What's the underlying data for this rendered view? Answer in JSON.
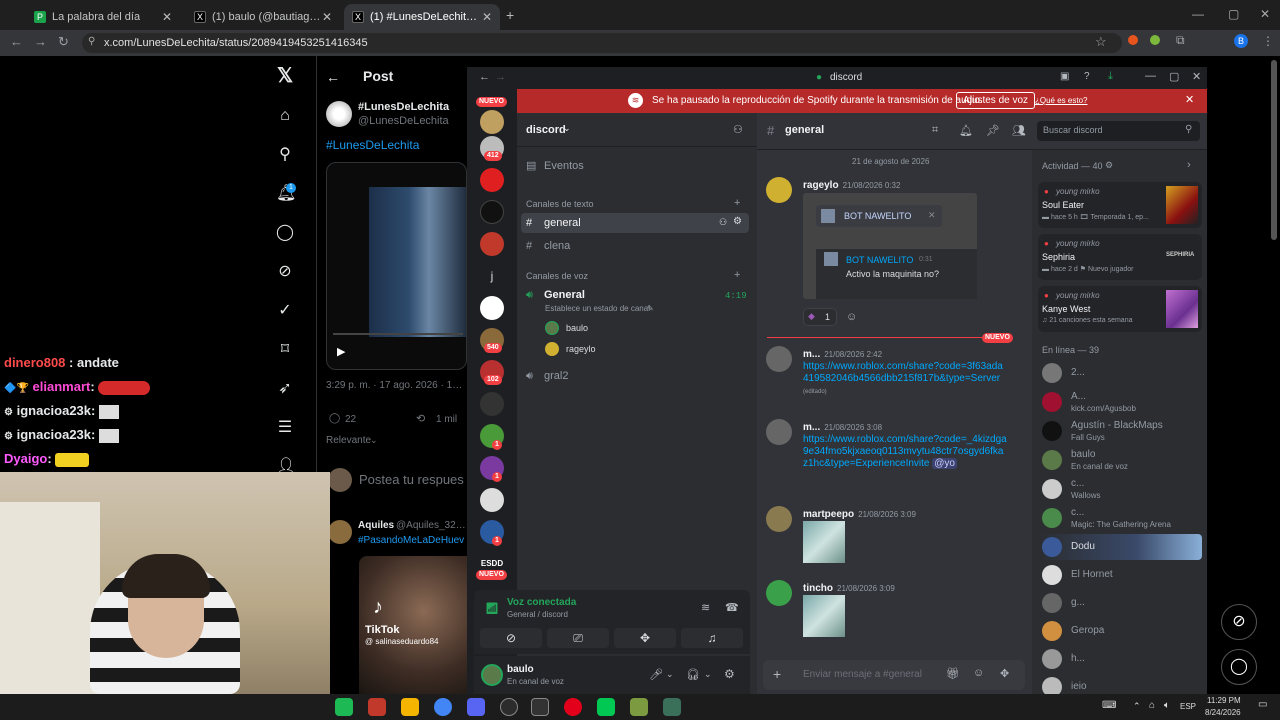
{
  "browser": {
    "tabs": [
      {
        "title": "La palabra del día",
        "fav": "P",
        "fav_color": "#1aa34a"
      },
      {
        "title": "(1) baulo (@bautiagnone) / X",
        "fav": "X",
        "fav_color": "#000000"
      },
      {
        "title": "(1) #LunesDeLechita en X: \"#Lu",
        "fav": "X",
        "fav_color": "#000000"
      }
    ],
    "new_tab": "+",
    "url": "x.com/LunesDeLechita/status/2089419453251416345"
  },
  "x_page": {
    "header_title": "Post",
    "post": {
      "display_name": "#LunesDeLechita",
      "handle": "@LunesDeLechita",
      "body": "#LunesDeLechita",
      "timestamp": "3:29 p. m. · 17 ago. 2026 · 134,9",
      "replies": "22",
      "reposts": "1 mil",
      "sort": "Relevante",
      "reply_placeholder": "Postea tu respues"
    },
    "reply": {
      "name": "Aquiles",
      "handle": "@Aquiles_32 · 1",
      "text": "#PasandoMeLaDeHuev",
      "tiktok_brand": "TikTok",
      "tiktok_user": "@ salinaseduardo84"
    },
    "notif_count": "1"
  },
  "stream_chat": [
    {
      "user": "dinero808",
      "text": ": andate",
      "color": "#ff4b4b"
    },
    {
      "user": "elianmart",
      "text": ":",
      "color": "#ff4bd6"
    },
    {
      "user": "ignacioa23k",
      "text": ":",
      "color": "#ffffff"
    },
    {
      "user": "ignacioa23k",
      "text": ":",
      "color": "#ffffff"
    },
    {
      "user": "Dyaigo",
      "text": ":",
      "color": "#ff5bff"
    }
  ],
  "discord": {
    "window_title": "discord",
    "spotify_notice": "Se ha pausado la reproducción de Spotify durante la transmisión de audio.",
    "spotify_button": "Ajustes de voz",
    "spotify_link": "¿Qué es esto?",
    "guild_badges": [
      "NUEVO",
      "412",
      "540",
      "102",
      "1",
      "1",
      "1",
      "NUEVO"
    ],
    "guild_letter": "j",
    "guild_text": "ESDD",
    "server_name": "discord",
    "events": "Eventos",
    "text_category": "Canales de texto",
    "text_channels": [
      "general",
      "clena"
    ],
    "voice_category": "Canales de voz",
    "voice_channel": {
      "name": "General",
      "timer": "4:19",
      "status": "Establece un estado de canal"
    },
    "voice_users": [
      "baulo",
      "rageylo"
    ],
    "other_voice": "gral2",
    "voice_panel": {
      "title": "Voz conectada",
      "sub": "General / discord"
    },
    "user_panel": {
      "name": "baulo",
      "status": "En canal de voz"
    },
    "channel_header": "general",
    "search_placeholder": "Buscar discord",
    "date_divider": "21 de agosto de 2026",
    "messages": [
      {
        "author": "rageylo",
        "time": "21/08/2026 0:32",
        "embed_bot": "BOT NAWELITO",
        "embed_bot2": "BOT NAWELITO",
        "embed_time": "0:31",
        "embed_text": "Activo la maquinita no?",
        "reaction_count": "1"
      },
      {
        "author": "m...",
        "time": "21/08/2026 2:42",
        "link": "https://www.roblox.com/share?code=3f63ada419582046b4566dbb215f817b&type=Server",
        "edited": "(editado)",
        "new_label": "NUEVO"
      },
      {
        "author": "m...",
        "time": "21/08/2026 3:08",
        "link": "https://www.roblox.com/share?code=_4kizdga9e34fmo5kjxaeoq0113mvytu48ctr7osgyd6fkaz1hc&type=ExperienceInvite",
        "mention": "@yo"
      },
      {
        "author": "martpeepo",
        "time": "21/08/2026 3:09"
      },
      {
        "author": "tincho",
        "time": "21/08/2026 3:09"
      }
    ],
    "composer_placeholder": "Enviar mensaje a #general",
    "activity_header": "Actividad — 40",
    "activities": [
      {
        "user": "young mirko",
        "title": "Soul Eater",
        "sub1": "hace 5 h",
        "sub2": "Temporada 1, ep..."
      },
      {
        "user": "young mirko",
        "title": "Sephiria",
        "sub1": "hace 2 d",
        "sub2": "Nuevo jugador",
        "art": "SEPHIRIA"
      },
      {
        "user": "young mirko",
        "title": "Kanye West",
        "sub1": "21 canciones esta semana"
      }
    ],
    "online_header": "En línea — 39",
    "members": [
      {
        "name": "2...",
        "sub": ""
      },
      {
        "name": "A...",
        "sub": "kick.com/Agusbob"
      },
      {
        "name": "Agustín - BlackMaps",
        "sub": "Fall Guys"
      },
      {
        "name": "baulo",
        "sub": "En canal de voz"
      },
      {
        "name": "c...",
        "sub": "Wallows"
      },
      {
        "name": "c...",
        "sub": "Magic: The Gathering Arena"
      },
      {
        "name": "Dodu",
        "sub": ""
      },
      {
        "name": "El Hornet",
        "sub": ""
      },
      {
        "name": "g...",
        "sub": ""
      },
      {
        "name": "Geropa",
        "sub": ""
      },
      {
        "name": "h...",
        "sub": ""
      },
      {
        "name": "ieio",
        "sub": ""
      }
    ]
  },
  "taskbar": {
    "lang": "ESP",
    "time": "11:29 PM",
    "date": "8/24/2026",
    "icon_colors": [
      "#1db954",
      "#c0392b",
      "#f4b400",
      "#4285f4",
      "#5865f2",
      "#2c2c2c",
      "#333333",
      "#e3001b",
      "#00c853",
      "#7c9a3f",
      "#3a6f5a"
    ]
  },
  "colors": {
    "discord_bg": "#313338",
    "discord_side": "#2b2d31",
    "discord_rail": "#1e1f22",
    "spotify_bar": "#b72a2a",
    "x_link": "#1d9bf0",
    "voice_green": "#23a55a"
  }
}
